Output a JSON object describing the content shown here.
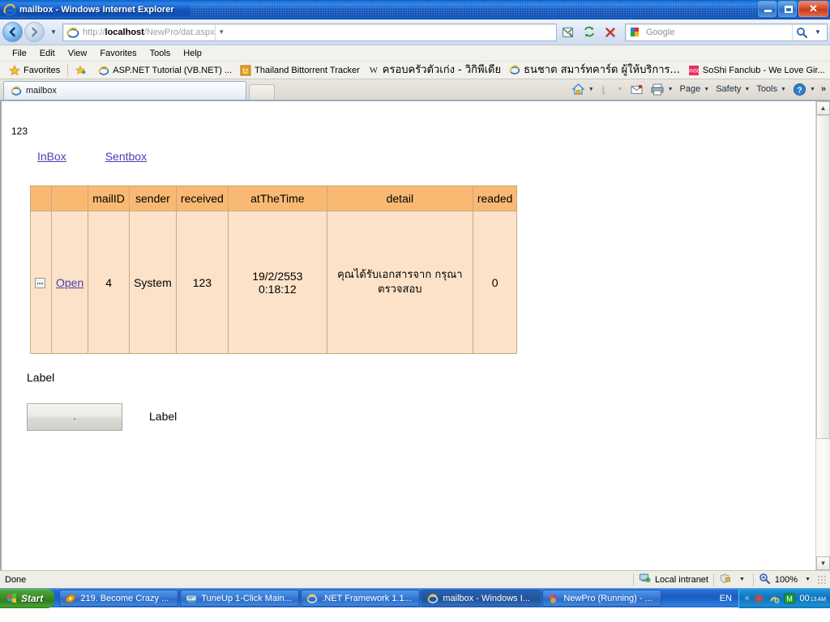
{
  "window": {
    "title": "mailbox - Windows Internet Explorer",
    "icon": "ie-icon",
    "minimize_label": "Minimize",
    "restore_label": "Restore",
    "close_label": "Close"
  },
  "nav": {
    "back_label": "Back",
    "forward_label": "Forward",
    "recent_pages_label": "Recent Pages",
    "address": {
      "scheme": "http://",
      "host": "localhost",
      "path": "/NewPro/dat.aspx",
      "full": "http://localhost/NewPro/dat.aspx"
    },
    "buttons": [
      {
        "name": "compatibility-view-button",
        "label": "Compatibility View"
      },
      {
        "name": "refresh-button",
        "label": "Refresh"
      },
      {
        "name": "stop-button",
        "label": "Stop"
      }
    ],
    "search": {
      "provider": "Google",
      "placeholder": "Google",
      "value": "",
      "search_label": "Search",
      "dropdown_label": "Search Options"
    }
  },
  "menubar": {
    "items": [
      "File",
      "Edit",
      "View",
      "Favorites",
      "Tools",
      "Help"
    ]
  },
  "favorites_bar": {
    "favorites_label": "Favorites",
    "items": [
      {
        "label": "ASP.NET Tutorial (VB.NET) ...",
        "icon": "ie-icon"
      },
      {
        "label": "Thailand Bittorrent Tracker",
        "icon": "tz-icon"
      },
      {
        "label": "ครอบครัวตัวเก่ง - วิกิพีเดีย",
        "icon": "wikipedia-icon"
      },
      {
        "label": "ธนชาต สมาร์ทคาร์ด ผู้ให้บริการ...",
        "icon": "ie-icon"
      },
      {
        "label": "SoShi Fanclub - We Love Gir...",
        "icon": "soshi-icon"
      }
    ]
  },
  "tabs": {
    "items": [
      {
        "label": "mailbox",
        "icon": "ie-icon",
        "active": true
      }
    ],
    "new_tab_label": "New Tab"
  },
  "command_bar": {
    "items": [
      {
        "name": "home-button",
        "label": "",
        "icon": "home-icon",
        "has_caret": true
      },
      {
        "name": "feeds-button",
        "label": "",
        "icon": "rss-icon",
        "has_caret": true
      },
      {
        "name": "read-mail-button",
        "label": "",
        "icon": "mail-icon",
        "has_caret": false
      },
      {
        "name": "print-button",
        "label": "",
        "icon": "printer-icon",
        "has_caret": true
      },
      {
        "name": "page-menu",
        "label": "Page",
        "icon": "",
        "has_caret": true
      },
      {
        "name": "safety-menu",
        "label": "Safety",
        "icon": "",
        "has_caret": true
      },
      {
        "name": "tools-menu",
        "label": "Tools",
        "icon": "",
        "has_caret": true
      },
      {
        "name": "help-menu",
        "label": "",
        "icon": "help-icon",
        "has_caret": true
      }
    ],
    "overflow_label": "»"
  },
  "page": {
    "top_text": "123",
    "nav_links": [
      {
        "label": "InBox",
        "name": "inbox-link"
      },
      {
        "label": "Sentbox",
        "name": "sentbox-link"
      }
    ],
    "table": {
      "headers": [
        "",
        "",
        "mailID",
        "sender",
        "received",
        "atTheTime",
        "detail",
        "readed"
      ],
      "rows": [
        {
          "select_icon": "broken-image-icon",
          "open_label": "Open",
          "mailID": "4",
          "sender": "System",
          "received": "123",
          "atTheTime": "19/2/2553 0:18:12",
          "detail": "คุณได้รับเอกสารจาก กรุณาตรวจสอบ",
          "readed": "0"
        }
      ],
      "header_bg": "#fab973",
      "cell_bg": "#fce2c8",
      "border_color": "#c8a882"
    },
    "label_top": "Label",
    "button_text": ".",
    "label_right": "Label"
  },
  "statusbar": {
    "status": "Done",
    "zone": "Local intranet",
    "zone_icon": "intranet-icon",
    "protected_mode_icon": "security-icon",
    "zoom": "100%",
    "zoom_icon": "zoom-icon"
  },
  "taskbar": {
    "start_label": "Start",
    "tasks": [
      {
        "label": "219. Become Crazy ...",
        "icon": "media-icon",
        "active": false
      },
      {
        "label": "TuneUp 1-Click Main...",
        "icon": "tuneup-icon",
        "active": false
      },
      {
        "label": ".NET Framework 1.1...",
        "icon": "ie-icon",
        "active": false
      },
      {
        "label": "mailbox - Windows I...",
        "icon": "ie-icon",
        "active": true
      },
      {
        "label": "NewPro (Running) - ...",
        "icon": "vs-icon",
        "active": false
      }
    ],
    "language": "EN",
    "tray_chevron": "«",
    "tray_icons": [
      "antivirus-icon",
      "network-icon",
      "monitor-icon"
    ],
    "clock_time": "00",
    "clock_minutes": "13",
    "clock_ampm": "AM"
  }
}
